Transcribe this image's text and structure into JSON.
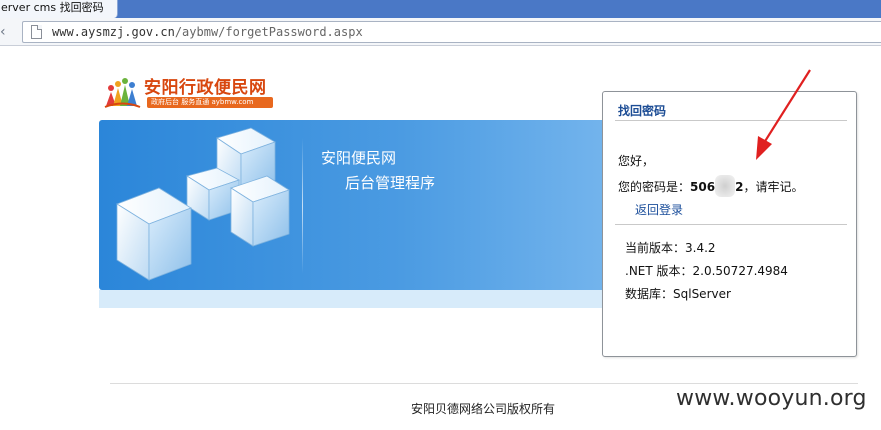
{
  "browser": {
    "tab_title": "erver cms 找回密码",
    "url_host": "www.aysmzj.gov.cn",
    "url_path": "/aybmw/forgetPassword.aspx"
  },
  "logo": {
    "title": "安阳行政便民网",
    "subtitle": "政府后台 服务直通 aybmw.com"
  },
  "banner": {
    "title": "安阳便民网",
    "subtitle": "后台管理程序"
  },
  "panel": {
    "title": "找回密码",
    "greeting": "您好，",
    "password_prefix": "您的密码是：",
    "password_visible_start": "506",
    "password_visible_end": "2",
    "password_suffix": "，请牢记。",
    "return_link": "返回登录",
    "version_line": "当前版本：3.4.2",
    "dotnet_line": ".NET 版本：2.0.50727.4984",
    "database_line": "数据库：SqlServer"
  },
  "footer": {
    "copyright": "安阳贝德网络公司版权所有"
  },
  "watermark": "www.wooyun.org",
  "colors": {
    "banner_blue": "#2b86d9",
    "link_blue": "#1b4e9b",
    "logo_orange": "#d8470f",
    "annotation_red": "#e02020"
  }
}
